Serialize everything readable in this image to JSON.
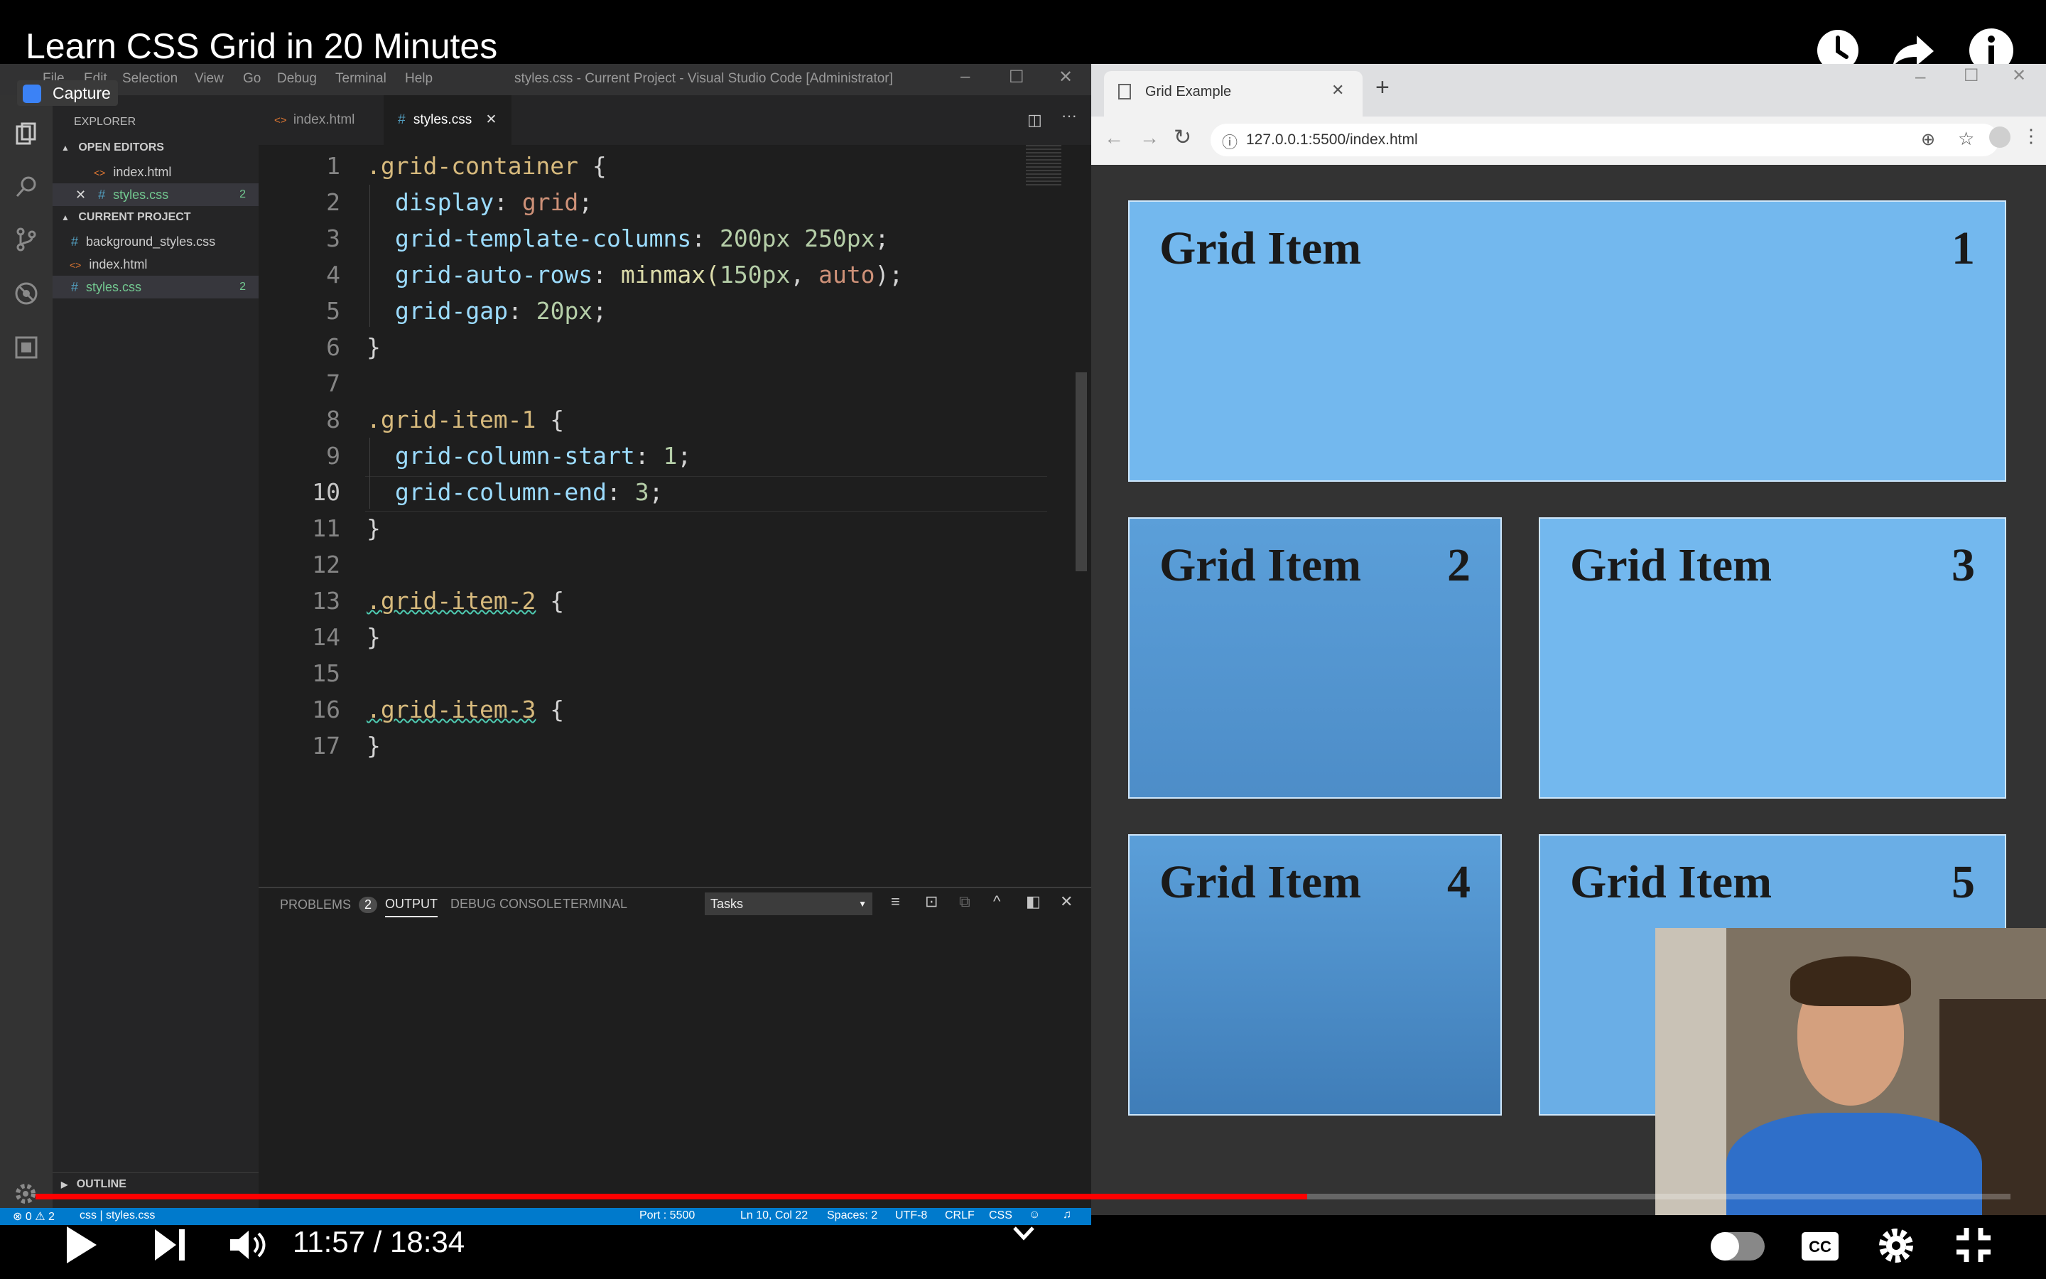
{
  "video": {
    "title": "Learn CSS Grid in 20 Minutes",
    "time_current": "11:57",
    "time_separator": "/",
    "time_total": "18:34",
    "progress": 0.644
  },
  "overlay": {
    "capture_label": "Capture"
  },
  "vscode": {
    "menu": [
      "File",
      "Edit",
      "Selection",
      "View",
      "Go",
      "Debug",
      "Terminal",
      "Help"
    ],
    "window_title": "styles.css - Current Project - Visual Studio Code [Administrator]",
    "explorer_label": "EXPLORER",
    "open_editors_label": "OPEN EDITORS",
    "open_editors": [
      {
        "name": "index.html",
        "badge": ""
      },
      {
        "name": "styles.css",
        "badge": "2"
      }
    ],
    "project_label": "CURRENT PROJECT",
    "project_files": [
      {
        "name": "background_styles.css",
        "badge": ""
      },
      {
        "name": "index.html",
        "badge": ""
      },
      {
        "name": "styles.css",
        "badge": "2"
      }
    ],
    "outline_label": "OUTLINE",
    "tabs": [
      {
        "label": "index.html"
      },
      {
        "label": "styles.css"
      }
    ],
    "code_lines": [
      "1",
      "2",
      "3",
      "4",
      "5",
      "6",
      "7",
      "8",
      "9",
      "10",
      "11",
      "12",
      "13",
      "14",
      "15",
      "16",
      "17"
    ],
    "code": {
      "l1_sel": ".grid-container",
      "l1_brace": " {",
      "l2_prop": "display",
      "l2_val": "grid",
      "l3_prop": "grid-template-columns",
      "l3_val": "200px 250px",
      "l4_prop": "grid-auto-rows",
      "l4_fn": "minmax(",
      "l4_a": "150px",
      "l4_b": "auto",
      "l4_close": ");",
      "l5_prop": "grid-gap",
      "l5_val": "20px",
      "close": "}",
      "l8_sel": ".grid-item-1",
      "l9_prop": "grid-column-start",
      "l9_val": "1",
      "l10_prop": "grid-column-end",
      "l10_val": "3",
      "l13_sel": ".grid-item-2",
      "l16_sel": ".grid-item-3",
      "open": " {"
    },
    "panel_tabs": {
      "problems": "PROBLEMS",
      "problems_count": "2",
      "output": "OUTPUT",
      "debug": "DEBUG CONSOLE",
      "terminal": "TERMINAL"
    },
    "panel_select": "Tasks",
    "status": {
      "errors": "0",
      "warnings": "2",
      "branch": "css | styles.css",
      "port": "Port : 5500",
      "position": "Ln 10, Col 22",
      "spaces": "Spaces: 2",
      "encoding": "UTF-8",
      "eol": "CRLF",
      "lang": "CSS"
    }
  },
  "browser": {
    "tab_title": "Grid Example",
    "url": "127.0.0.1:5500/index.html",
    "grid_items": [
      {
        "label": "Grid Item",
        "num": "1"
      },
      {
        "label": "Grid Item",
        "num": "2"
      },
      {
        "label": "Grid Item",
        "num": "3"
      },
      {
        "label": "Grid Item",
        "num": "4"
      },
      {
        "label": "Grid Item",
        "num": "5"
      }
    ]
  }
}
